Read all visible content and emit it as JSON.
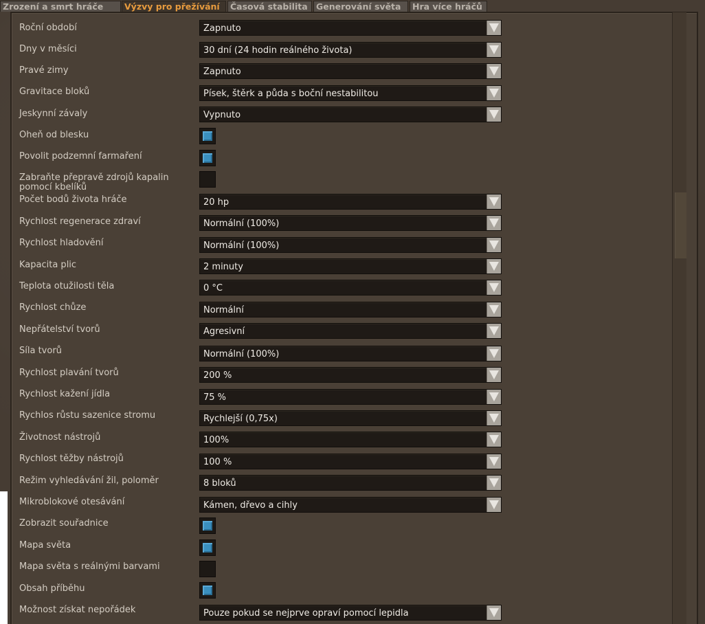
{
  "tabs": [
    {
      "label": "Zrození a smrt hráče",
      "active": false
    },
    {
      "label": "Výzvy pro přežívání",
      "active": true
    },
    {
      "label": "Časová stabilita",
      "active": false
    },
    {
      "label": "Generování světa",
      "active": false
    },
    {
      "label": "Hra více hráčů",
      "active": false
    }
  ],
  "settings": [
    {
      "label": "Roční období",
      "type": "select",
      "value": "Zapnuto"
    },
    {
      "label": "Dny v měsíci",
      "type": "select",
      "value": "30 dní (24 hodin reálného života)"
    },
    {
      "label": "Pravé zimy",
      "type": "select",
      "value": "Zapnuto"
    },
    {
      "label": "Gravitace bloků",
      "type": "select",
      "value": "Písek, štěrk a půda s boční nestabilitou"
    },
    {
      "label": "Jeskynní závaly",
      "type": "select",
      "value": "Vypnuto"
    },
    {
      "label": "Oheň od blesku",
      "type": "checkbox",
      "checked": true
    },
    {
      "label": "Povolit podzemní farmaření",
      "type": "checkbox",
      "checked": true
    },
    {
      "label": "Zabraňte přepravě zdrojů kapalin pomocí kbelíků",
      "type": "checkbox",
      "checked": false
    },
    {
      "label": "Počet bodů života hráče",
      "type": "select",
      "value": "20 hp"
    },
    {
      "label": "Rychlost regenerace zdraví",
      "type": "select",
      "value": "Normální (100%)"
    },
    {
      "label": "Rychlost hladovění",
      "type": "select",
      "value": "Normální (100%)"
    },
    {
      "label": "Kapacita plic",
      "type": "select",
      "value": "2 minuty"
    },
    {
      "label": "Teplota otužilosti těla",
      "type": "select",
      "value": "0 °C"
    },
    {
      "label": "Rychlost chůze",
      "type": "select",
      "value": "Normální"
    },
    {
      "label": "Nepřátelství tvorů",
      "type": "select",
      "value": "Agresivní"
    },
    {
      "label": "Síla tvorů",
      "type": "select",
      "value": "Normální (100%)"
    },
    {
      "label": "Rychlost plavání tvorů",
      "type": "select",
      "value": "200 %"
    },
    {
      "label": "Rychlost kažení jídla",
      "type": "select",
      "value": "75 %"
    },
    {
      "label": "Rychlos růstu sazenice stromu",
      "type": "select",
      "value": "Rychlejší (0,75x)"
    },
    {
      "label": "Životnost nástrojů",
      "type": "select",
      "value": "100%"
    },
    {
      "label": "Rychlost těžby nástrojů",
      "type": "select",
      "value": "100 %"
    },
    {
      "label": "Režim vyhledávání žil, poloměr",
      "type": "select",
      "value": "8 bloků"
    },
    {
      "label": "Mikroblokové otesávání",
      "type": "select",
      "value": "Kámen, dřevo a cihly"
    },
    {
      "label": "Zobrazit souřadnice",
      "type": "checkbox",
      "checked": true
    },
    {
      "label": "Mapa světa",
      "type": "checkbox",
      "checked": true
    },
    {
      "label": "Mapa světa s reálnými barvami",
      "type": "checkbox",
      "checked": false
    },
    {
      "label": "Obsah příběhu",
      "type": "checkbox",
      "checked": true
    },
    {
      "label": "Možnost získat nepořádek",
      "type": "select",
      "value": "Pouze pokud se nejprve opraví pomocí lepidla"
    }
  ],
  "icons": {
    "dropdown": "chevron-down-icon",
    "checkmark": "checkbox-checked-icon"
  },
  "colors": {
    "active_tab": "#e79b3e",
    "checkbox_fill": "#3a8fbe"
  }
}
